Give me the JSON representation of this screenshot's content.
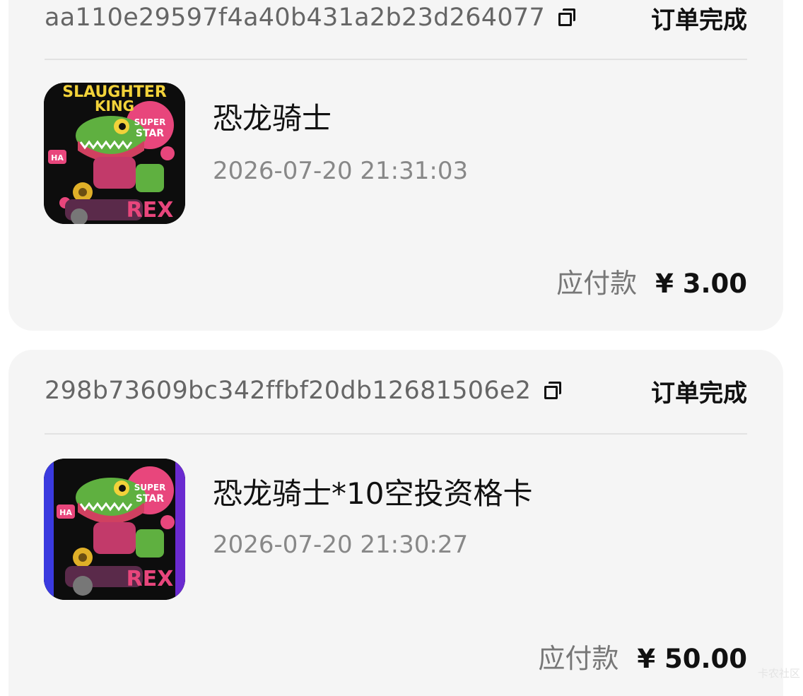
{
  "orders": [
    {
      "order_id": "aa110e29597f4a40b431a2b23d264077",
      "status": "订单完成",
      "thumbnail_icon": "dinosaur-rider-image",
      "product_name": "恐龙骑士",
      "time": "2026-07-20 21:31:03",
      "price_label": "应付款",
      "price": "¥ 3.00"
    },
    {
      "order_id": "298b73609bc342ffbf20db12681506e2",
      "status": "订单完成",
      "thumbnail_icon": "dinosaur-rider-image",
      "product_name": "恐龙骑士*10空投资格卡",
      "time": "2026-07-20 21:30:27",
      "price_label": "应付款",
      "price": "¥ 50.00"
    }
  ],
  "thumbnail_text": {
    "top": "SLAUGHTER",
    "sub": "KING",
    "badge_line1": "SUPER",
    "badge_line2": "STAR",
    "rex": "REX",
    "ha": "HA"
  },
  "colors": {
    "card_bg": "#f5f5f5",
    "dino_green": "#5fb040",
    "accent_pink": "#e8467c",
    "accent_yellow": "#f2d23a"
  },
  "watermark": "卡农社区"
}
